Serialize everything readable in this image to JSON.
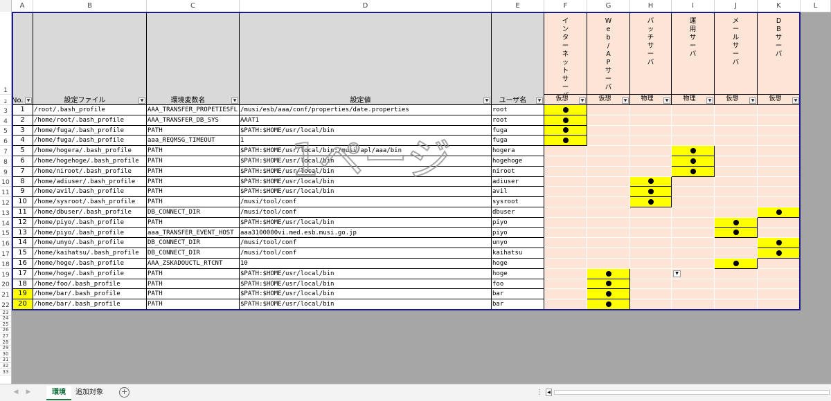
{
  "column_letters": [
    "A",
    "B",
    "C",
    "D",
    "E",
    "F",
    "G",
    "H",
    "I",
    "J",
    "K",
    "L"
  ],
  "headers": {
    "no": "No.",
    "file": "設定ファイル",
    "env": "環境変数名",
    "value": "設定値",
    "user": "ユーザ名"
  },
  "servers": [
    {
      "name": "インターネットサーバ",
      "type": "仮想"
    },
    {
      "name": "Web/APサーバ",
      "type": "仮想"
    },
    {
      "name": "バッチサーバ",
      "type": "物理"
    },
    {
      "name": "運用サーバ",
      "type": "物理"
    },
    {
      "name": "メールサーバ",
      "type": "仮想"
    },
    {
      "name": "DBサーバ",
      "type": "仮想"
    }
  ],
  "rows": [
    {
      "no": "1",
      "file": "/root/.bash_profile",
      "env": "AAA_TRANSFER_PROPETIESFL",
      "value": "/musi/esb/aaa/conf/properties/date.properties",
      "user": "root",
      "marks": [
        0
      ]
    },
    {
      "no": "2",
      "file": "/home/root/.bash_profile",
      "env": "AAA_TRANSFER_DB_SYS",
      "value": "AAAT1",
      "user": "root",
      "marks": [
        0
      ]
    },
    {
      "no": "3",
      "file": "/home/fuga/.bash_profile",
      "env": "PATH",
      "value": "$PATH:$HOME/usr/local/bin",
      "user": "fuga",
      "marks": [
        0
      ]
    },
    {
      "no": "4",
      "file": "/home/fuga/.bash_profile",
      "env": "aaa_REQMSG_TIMEOUT",
      "value": "1",
      "user": "fuga",
      "marks": [
        0
      ]
    },
    {
      "no": "5",
      "file": "/home/hogera/.bash_profile",
      "env": "PATH",
      "value": "$PATH:$HOME/usr/local/bin:/musi/apl/aaa/bin",
      "user": "hogera",
      "marks": [
        3
      ]
    },
    {
      "no": "6",
      "file": "/home/hogehoge/.bash_profile",
      "env": "PATH",
      "value": "$PATH:$HOME/usr/local/bin",
      "user": "hogehoge",
      "marks": [
        3
      ]
    },
    {
      "no": "7",
      "file": "/home/niroot/.bash_profile",
      "env": "PATH",
      "value": "$PATH:$HOME/usr/local/bin",
      "user": "niroot",
      "marks": [
        3
      ]
    },
    {
      "no": "8",
      "file": "/home/adiuser/.bash_profile",
      "env": "PATH",
      "value": "$PATH:$HOME/usr/local/bin",
      "user": "adiuser",
      "marks": [
        2
      ]
    },
    {
      "no": "9",
      "file": "/home/avil/.bash_profile",
      "env": "PATH",
      "value": "$PATH:$HOME/usr/local/bin",
      "user": "avil",
      "marks": [
        2
      ]
    },
    {
      "no": "10",
      "file": "/home/sysroot/.bash_profile",
      "env": "PATH",
      "value": "/musi/tool/conf",
      "user": "sysroot",
      "marks": [
        2
      ]
    },
    {
      "no": "11",
      "file": "/home/dbuser/.bash_profile",
      "env": "DB_CONNECT_DIR",
      "value": "/musi/tool/conf",
      "user": "dbuser",
      "marks": [
        5
      ]
    },
    {
      "no": "12",
      "file": "/home/piyo/.bash_profile",
      "env": "PATH",
      "value": "$PATH:$HOME/usr/local/bin",
      "user": "piyo",
      "marks": [
        4
      ]
    },
    {
      "no": "13",
      "file": "/home/piyo/.bash_profile",
      "env": "aaa_TRANSFER_EVENT_HOST",
      "value": "aaa3100000vi.med.esb.musi.go.jp",
      "user": "piyo",
      "marks": [
        4
      ]
    },
    {
      "no": "14",
      "file": "/home/unyo/.bash_profile",
      "env": "DB_CONNECT_DIR",
      "value": "/musi/tool/conf",
      "user": "unyo",
      "marks": [
        5
      ]
    },
    {
      "no": "15",
      "file": "/home/kaihatsu/.bash_profile",
      "env": "DB_CONNECT_DIR",
      "value": "/musi/tool/conf",
      "user": "kaihatsu",
      "marks": [
        5
      ]
    },
    {
      "no": "16",
      "file": "/home/hoge/.bash_profile",
      "env": "AAA_ZSKADOUCTL_RTCNT",
      "value": "10",
      "user": "hoge",
      "marks": [
        4
      ]
    },
    {
      "no": "17",
      "file": "/home/hoge/.bash_profile",
      "env": "PATH",
      "value": "$PATH:$HOME/usr/local/bin",
      "user": "hoge",
      "marks": [
        1
      ]
    },
    {
      "no": "18",
      "file": "/home/foo/.bash_profile",
      "env": "PATH",
      "value": "$PATH:$HOME/usr/local/bin",
      "user": "foo",
      "marks": [
        1
      ]
    },
    {
      "no": "19",
      "file": "/home/bar/.bash_profile",
      "env": "PATH",
      "value": "$PATH:$HOME/usr/local/bin",
      "user": "bar",
      "marks": [
        1
      ],
      "no_highlight": true
    },
    {
      "no": "20",
      "file": "/home/bar/.bash_profile",
      "env": "PATH",
      "value": "$PATH:$HOME/usr/local/bin",
      "user": "bar",
      "marks": [
        1
      ],
      "no_highlight": true
    }
  ],
  "watermark": "1ページ",
  "mark_symbol": "●",
  "sheet_tabs": [
    {
      "label": "環境",
      "active": true
    },
    {
      "label": "追加対象",
      "active": false
    }
  ],
  "add_sheet_symbol": "+",
  "colors": {
    "accent": "#217346",
    "mark_fill": "#ffff00",
    "server_fill": "#fce4d6",
    "header_fill": "#d9d9d9",
    "table_border": "#1a1a8c"
  }
}
